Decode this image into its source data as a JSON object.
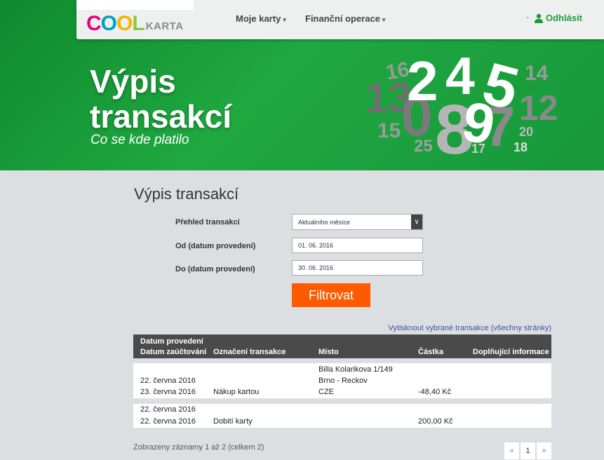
{
  "header": {
    "logo_cool_letters": [
      "C",
      "O",
      "O",
      "L"
    ],
    "logo_karta": "KARTA",
    "nav": [
      {
        "label": "Moje karty"
      },
      {
        "label": "Finanční operace"
      }
    ],
    "logout_label": "Odhlásit"
  },
  "hero": {
    "title_line1": "Výpis",
    "title_line2": "transakcí",
    "subtitle": "Co se kde platilo",
    "numbers": [
      "16",
      "2",
      "4",
      "5",
      "14",
      "13",
      "0",
      "8",
      "9",
      "12",
      "15",
      "7",
      "20",
      "25",
      "17",
      "18"
    ]
  },
  "main": {
    "title": "Výpis transakcí",
    "form": {
      "overview_label": "Přehled transakcí",
      "overview_value": "Aktuálního měsíce",
      "from_label": "Od (datum provedení)",
      "from_value": "01. 06. 2016",
      "to_label": "Do (datum provedení)",
      "to_value": "30. 06. 2016",
      "filter_button": "Filtrovat"
    },
    "print_link": "Vytisknout vybrané transakce (všechny stránky)",
    "table": {
      "headers": {
        "date_performed": "Datum provedení",
        "date_posted": "Datum zaúčtování",
        "designation": "Označení transakce",
        "place": "Místo",
        "amount": "Částka",
        "additional": "Doplňující informace"
      },
      "rows": [
        {
          "date_performed": "22. června 2016",
          "date_posted": "23. června 2016",
          "designation": "Nákup kartou",
          "place_line1": "Billa Kolarikova 1/149",
          "place_line2": "Brno - Reckov",
          "place_line3": "CZE",
          "amount": "-48,40 Kč",
          "additional": ""
        },
        {
          "date_performed": "22. června 2016",
          "date_posted": "22. června 2016",
          "designation": "Dobití karty",
          "place_line1": "",
          "place_line2": "",
          "place_line3": "",
          "amount": "200,00 Kč",
          "additional": ""
        }
      ]
    },
    "records_info": "Zobrazeny záznamy 1 až 2 (celkem 2)",
    "pager": {
      "prev": "«",
      "page": "1",
      "next": "»"
    }
  }
}
